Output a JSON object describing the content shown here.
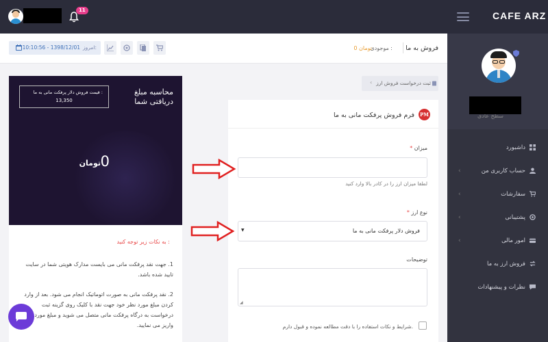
{
  "topbar": {
    "notification_count": "11",
    "logo_prefix": "CAFE",
    "logo_suffix": "ARZ"
  },
  "sidebar": {
    "profile_subtitle": "سطح عادی",
    "items": [
      {
        "label": "داشبورد",
        "icon": "dashboard-icon",
        "has_submenu": false
      },
      {
        "label": "حساب کاربری من",
        "icon": "user-icon",
        "has_submenu": true
      },
      {
        "label": "سفارشات",
        "icon": "cart-icon",
        "has_submenu": true
      },
      {
        "label": "پشتیبانی",
        "icon": "support-icon",
        "has_submenu": true
      },
      {
        "label": "امور مالی",
        "icon": "finance-icon",
        "has_submenu": true
      },
      {
        "label": "فروش ارز به ما",
        "icon": "exchange-icon",
        "has_submenu": false
      },
      {
        "label": "نظرات و پیشنهادات",
        "icon": "comment-icon",
        "has_submenu": false
      }
    ]
  },
  "header": {
    "title": "فروش به ما",
    "balance_label": "موجودی :",
    "balance_value": "0 تومان",
    "date_label": "امروز:",
    "date_value": "10:10:56 - 1398/12/01",
    "toolbar_icons": [
      "cart-icon",
      "wallet-icon",
      "ticket-icon",
      "chart-icon"
    ]
  },
  "breadcrumb": {
    "label": "ثبت درخواست فروش ارز"
  },
  "form": {
    "title": "فرم فروش پرفکت مانی به ما",
    "logo_text": "PM",
    "amount_label": "میزان",
    "amount_value": "",
    "amount_help": "لطفا میزان ارز را در کادر بالا وارد کنید",
    "currency_label": "نوع ارز",
    "currency_selected": "فروش دلار پرفکت مانی به ما",
    "description_label": "توضیحات",
    "description_value": "",
    "terms_label": "شرایط و نکات استفاده را با دقت مطالعه نموده و قبول دارم.",
    "required_mark": "*"
  },
  "calculator": {
    "title": "محاسبه مبلغ دریافتی شما",
    "rate_label": "قیمت فروش دلار پرفکت مانی به ما :",
    "rate_value": "13,350",
    "amount": "0",
    "unit": "تومان"
  },
  "notes": {
    "title": "به نکات زیر توجه کنید :",
    "items": [
      "1. جهت نقد پرفکت مانی می بایست مدارک هویتی شما در سایت تایید شده باشد.",
      "2. نقد پرفکت مانی به صورت اتوماتیک انجام می شود. بعد از وارد کردن مبلغ مورد نظر خود جهت نقد با کلیک روی گزینه ثبت درخواست به درگاه پرفکت مانی متصل می شوید و مبلغ مورد نظر را واریز می نمایید."
    ]
  },
  "colors": {
    "topbar": "#2b2c3a",
    "sidebar": "#32333f",
    "calc_bg": "#1e1431",
    "accent_red": "#e84545",
    "chat_fab": "#6c3bd8"
  }
}
